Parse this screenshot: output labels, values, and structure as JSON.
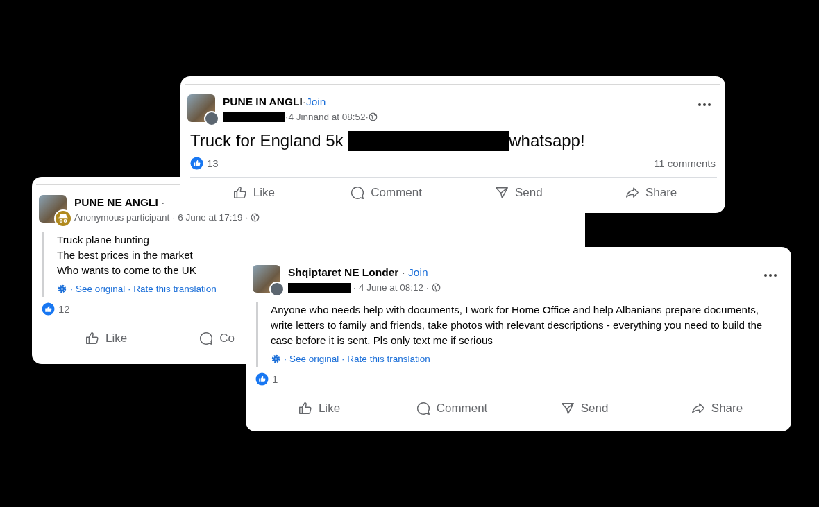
{
  "posts": [
    {
      "group": "PUNE IN ANGLI",
      "separator": "·",
      "join": "Join",
      "anonymous": false,
      "meta": [
        {
          "kind": "redacted"
        },
        {
          "kind": "text",
          "text": "·4 Jinnand at 08:52·"
        }
      ],
      "more_button": true,
      "kind": "original",
      "message": [
        [
          {
            "kind": "text",
            "text": "Truck for England 5k "
          },
          {
            "kind": "redacted"
          },
          {
            "kind": "text",
            "text": "whatsapp!"
          }
        ]
      ],
      "reaction_count": "13",
      "comments": "11 comments",
      "actions": [
        {
          "kind": "like",
          "label": "Like"
        },
        {
          "kind": "comment",
          "label": "Comment"
        },
        {
          "kind": "send",
          "label": "Send"
        },
        {
          "kind": "share",
          "label": "Share"
        }
      ]
    },
    {
      "group": "PUNE NE ANGLI",
      "separator": " ·",
      "anonymous": true,
      "meta": [
        {
          "kind": "text",
          "text": "Anonymous participant · 6 June at 17:19 · "
        }
      ],
      "more_button": false,
      "kind": "translated",
      "message": [
        [
          {
            "kind": "text",
            "text": "Truck plane hunting"
          }
        ],
        [
          {
            "kind": "text",
            "text": "The best prices in the market"
          }
        ],
        [
          {
            "kind": "text",
            "text": "Who wants to come to the UK"
          }
        ]
      ],
      "translation": {
        "separator": "·",
        "links": [
          "See original",
          "Rate this translation"
        ]
      },
      "reaction_count": "12",
      "actions": [
        {
          "kind": "like",
          "label": "Like"
        },
        {
          "kind": "comment",
          "label": "Co"
        }
      ]
    },
    {
      "group": "Shqiptaret NE Londer",
      "separator": " · ",
      "join": "Join",
      "anonymous": false,
      "meta": [
        {
          "kind": "redacted"
        },
        {
          "kind": "text",
          "text": " · 4 June at 08:12 · "
        }
      ],
      "more_button": true,
      "kind": "translated",
      "message": [
        [
          {
            "kind": "text",
            "text": "Anyone who needs help with documents, I work for Home Office and help Albanians prepare documents, write letters to family and friends, take photos with relevant descriptions - everything you need to build the case before it is sent. Pls only text me if serious"
          }
        ]
      ],
      "translation": {
        "separator": "·",
        "links": [
          "See original",
          "Rate this translation"
        ]
      },
      "reaction_count": "1",
      "actions": [
        {
          "kind": "like",
          "label": "Like"
        },
        {
          "kind": "comment",
          "label": "Comment"
        },
        {
          "kind": "send",
          "label": "Send"
        },
        {
          "kind": "share",
          "label": "Share"
        }
      ]
    }
  ]
}
